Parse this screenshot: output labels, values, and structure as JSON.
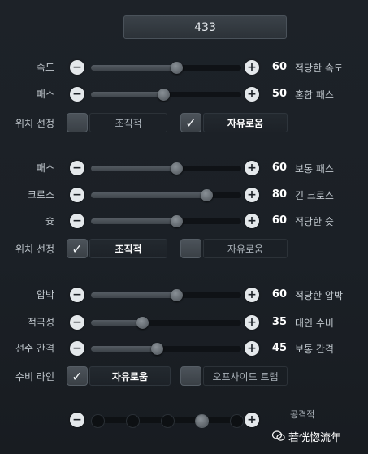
{
  "header": {
    "value": "433"
  },
  "group1": {
    "rows": [
      {
        "label": "속도",
        "value": "60",
        "desc": "적당한 속도",
        "level": 0.57
      },
      {
        "label": "패스",
        "value": "50",
        "desc": "혼합 패스",
        "level": 0.48
      }
    ],
    "position": {
      "label": "위치 선정",
      "option_a": {
        "label": "조직적",
        "checked": false
      },
      "option_b": {
        "label": "자유로움",
        "checked": true
      }
    }
  },
  "group2": {
    "rows": [
      {
        "label": "패스",
        "value": "60",
        "desc": "보통 패스",
        "level": 0.57
      },
      {
        "label": "크로스",
        "value": "80",
        "desc": "긴 크로스",
        "level": 0.77
      },
      {
        "label": "슛",
        "value": "60",
        "desc": "적당한 슛",
        "level": 0.57
      }
    ],
    "position": {
      "label": "위치 선정",
      "option_a": {
        "label": "조직적",
        "checked": true
      },
      "option_b": {
        "label": "자유로움",
        "checked": false
      }
    }
  },
  "group3": {
    "rows": [
      {
        "label": "압박",
        "value": "60",
        "desc": "적당한 압박",
        "level": 0.57
      },
      {
        "label": "적극성",
        "value": "35",
        "desc": "대인 수비",
        "level": 0.34
      },
      {
        "label": "선수 간격",
        "value": "45",
        "desc": "보통 간격",
        "level": 0.44
      }
    ],
    "defense_line": {
      "label": "수비 라인",
      "option_a": {
        "label": "자유로움",
        "checked": true
      },
      "option_b": {
        "label": "오프사이드 트랩",
        "checked": false
      }
    }
  },
  "bottom_slider": {
    "label": "공격적",
    "positions": 5,
    "selected_index": 3
  },
  "watermark": {
    "text": "若恍惚流年",
    "icon": "wechat-icon"
  },
  "colors": {
    "background": "#1a1f25",
    "knob": "#6b7278",
    "button": "#e4e8eb",
    "text_value": "#ffffff"
  }
}
